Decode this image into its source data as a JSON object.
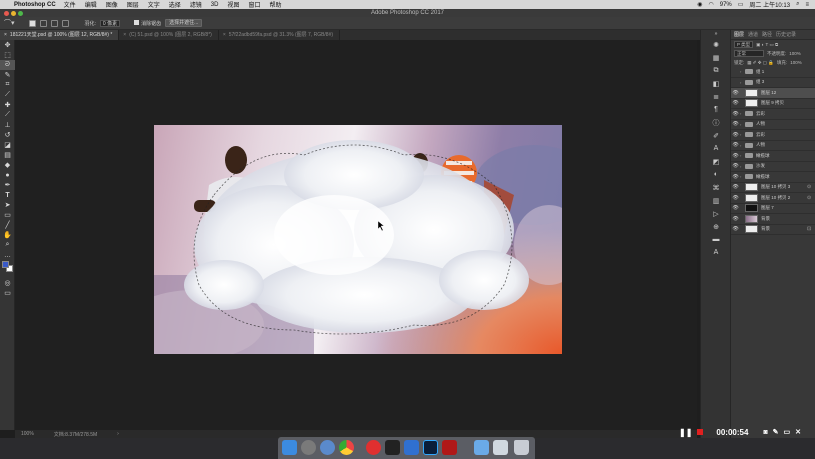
{
  "menubar": {
    "app": "Photoshop CC",
    "items": [
      "文件",
      "编辑",
      "图像",
      "图层",
      "文字",
      "选择",
      "滤镜",
      "3D",
      "视图",
      "窗口",
      "帮助"
    ],
    "battery": "97%",
    "clock": "周二 上午10:13"
  },
  "window": {
    "title": "Adobe Photoshop CC 2017"
  },
  "options": {
    "feather_label": "羽化:",
    "feather_value": "0 像素",
    "antialias_label": "消除锯齿",
    "select_mask_label": "选择并遮住..."
  },
  "tabs": [
    {
      "label": "181221天堂.psd @ 100% (图层 12, RGB/8#) *",
      "active": true
    },
    {
      "label": "(C) 51.psd @ 100% (图层 2, RGB/8*)",
      "active": false
    },
    {
      "label": "57f22adbd59fa.psd @ 31.3% (图层 7, RGB/8#)",
      "active": false
    }
  ],
  "status": {
    "zoom": "100%",
    "doc": "文档:8.37M/278.5M"
  },
  "panels": {
    "tabs": [
      "图层",
      "通道",
      "路径",
      "历史记录"
    ],
    "kind_label": "P 类型",
    "blend_mode": "正常",
    "opacity_label": "不透明度:",
    "opacity_value": "100%",
    "lock_label": "锁定:",
    "fill_label": "填充:",
    "fill_value": "100%"
  },
  "layers": [
    {
      "name": "组 1",
      "type": "group",
      "visible": false
    },
    {
      "name": "组 3",
      "type": "group",
      "visible": false
    },
    {
      "name": "图层 12",
      "type": "layer",
      "visible": true,
      "selected": true,
      "thumb": "light"
    },
    {
      "name": "图层 9 拷贝",
      "type": "layer",
      "visible": true,
      "thumb": "light"
    },
    {
      "name": "云彩",
      "type": "group",
      "visible": true
    },
    {
      "name": "人物",
      "type": "group",
      "visible": true
    },
    {
      "name": "云彩",
      "type": "group",
      "visible": true
    },
    {
      "name": "人物",
      "type": "group",
      "visible": true
    },
    {
      "name": "橄榄球",
      "type": "group",
      "visible": true
    },
    {
      "name": "沙发",
      "type": "group",
      "visible": true
    },
    {
      "name": "橄榄球",
      "type": "group",
      "visible": true
    },
    {
      "name": "图层 10 拷贝 3",
      "type": "layer",
      "visible": true,
      "thumb": "light",
      "linked": true
    },
    {
      "name": "图层 10 拷贝 2",
      "type": "layer",
      "visible": true,
      "thumb": "light",
      "linked": true
    },
    {
      "name": "图层 7",
      "type": "layer",
      "visible": true,
      "thumb": "dark"
    },
    {
      "name": "背景",
      "type": "layer",
      "visible": true,
      "thumb": "img"
    },
    {
      "name": "背景",
      "type": "layer",
      "visible": true,
      "thumb": "light",
      "locked": true
    }
  ],
  "recorder": {
    "time": "00:00:54"
  },
  "colors": {
    "accent": "#4a8ad8",
    "record": "#e02020"
  }
}
